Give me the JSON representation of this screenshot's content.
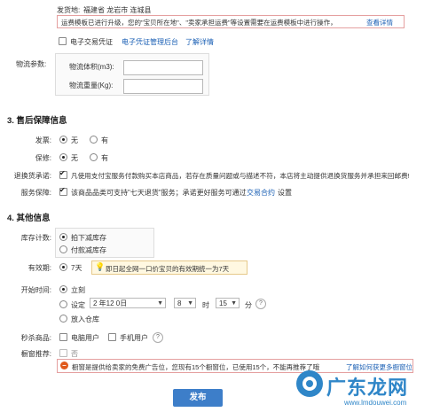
{
  "shipping": {
    "origin_label": "发货地:",
    "origin_value": "福建省 龙岩市 连城县",
    "notice_text": "运费模板已进行升级，您的\"宝贝所在地\"、\"卖家承担运费\"等设置需要在运费模板中进行操作，",
    "notice_link": "查看详情",
    "evoucher_label": "电子交易凭证",
    "evoucher_admin_link": "电子凭证管理后台",
    "evoucher_more_link": "了解详情",
    "logistics_label": "物流参数:",
    "volume_label": "物流体积(m3):",
    "weight_label": "物流重量(Kg):",
    "volume_value": "",
    "weight_value": ""
  },
  "after_sales": {
    "title": "3. 售后保障信息",
    "invoice_label": "发票:",
    "warranty_label": "保修:",
    "option_no": "无",
    "option_yes": "有",
    "return_label": "退换货承诺:",
    "return_text": "凡使用支付宝服务付款购买本店商品，若存在质量问题或与描述不符，本店将主动提供退换货服务并承担来回邮费!",
    "service_label": "服务保障:",
    "service_text": "该商品品类可支持\"七天退货\"服务；承诺更好服务可通过",
    "service_link": "交易合约",
    "service_tail": "设置"
  },
  "other_info": {
    "title": "4. 其他信息",
    "stock_label": "库存计数:",
    "stock_option_1": "拍下减库存",
    "stock_option_2": "付款减库存",
    "validity_label": "有效期:",
    "validity_value": "7天",
    "validity_tip": "即日起全网一口价宝贝的有效期统一为7天",
    "start_label": "开始时间:",
    "start_now": "立刻",
    "start_set": "设定",
    "date_value": "2  年12  0日",
    "hour_value": "8",
    "hour_unit": "时",
    "minute_value": "15",
    "minute_unit": "分",
    "start_store": "放入仓库",
    "flash_label": "秒杀商品:",
    "flash_pc": "电脑用户",
    "flash_mobile": "手机用户",
    "window_label": "橱窗推荐:",
    "window_no": "否",
    "window_notice": "橱窗是提供给卖家的免费广告位，您现有15个橱窗位，已使用15个，不能再推荐了哦",
    "window_link": "了解如何获更多橱窗位"
  },
  "publish_button": "发布",
  "watermark": {
    "title": "广东龙网",
    "url": "www.lmdouwei.com"
  },
  "colors": {
    "accent": "#3d7ec9",
    "link": "#1a5fb4",
    "warning_icon": "#e05a1c",
    "notice_border": "#e5a0a0"
  }
}
